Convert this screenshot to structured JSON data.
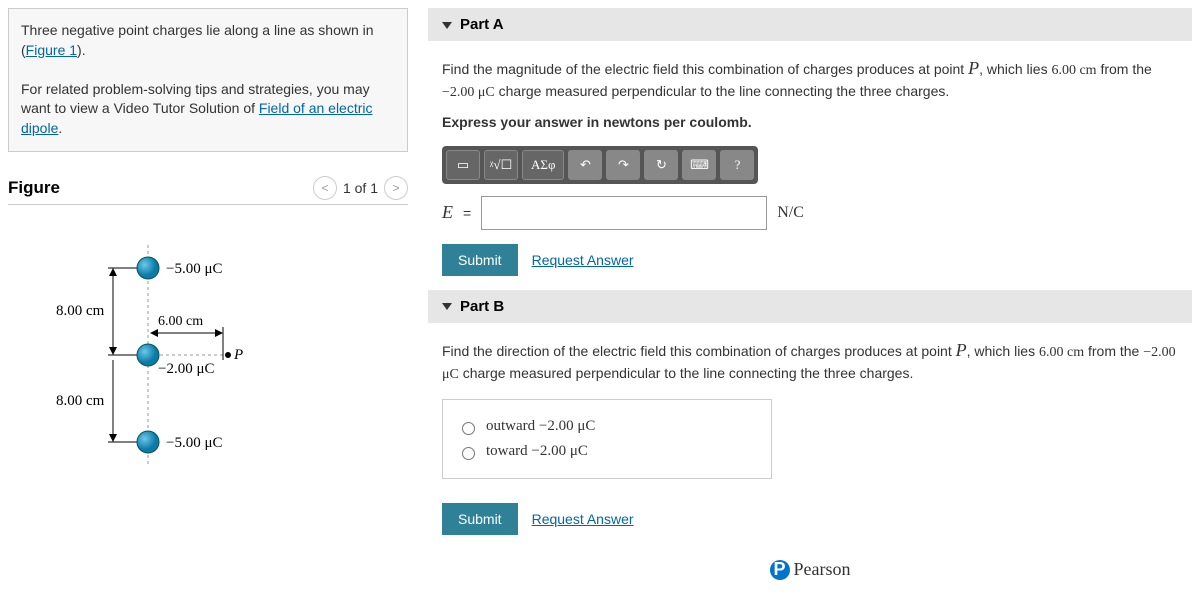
{
  "intro": {
    "l1a": "Three negative point charges lie along a line as shown in (",
    "l1_link": "Figure 1",
    "l1b": ").",
    "l2": "For related problem-solving tips and strategies, you may want to view a Video Tutor Solution of ",
    "l2_link": "Field of an electric dipole",
    "l2b": "."
  },
  "figure": {
    "title": "Figure",
    "counter": "1 of 1",
    "labels": {
      "q1": "−5.00 μC",
      "q2": "−2.00 μC",
      "q3": "−5.00 μC",
      "d1": "8.00 cm",
      "d2": "8.00 cm",
      "dP": "6.00 cm",
      "P": "P"
    }
  },
  "partA": {
    "title": "Part A",
    "q1": "Find the magnitude of the electric field this combination of charges produces at point ",
    "pvar": "P",
    "q2": ", which lies ",
    "dist": "6.00 cm",
    "q3": " from the ",
    "charge": "−2.00 μC",
    "q4": " charge measured perpendicular to the line connecting the three charges.",
    "instr": "Express your answer in newtons per coulomb.",
    "tools": {
      "tmpl": "▭",
      "sqrt": "ᵡ√☐",
      "greek": "ΑΣφ",
      "undo": "↶",
      "redo": "↷",
      "reset": "↻",
      "kbd": "⌨",
      "help": "?"
    },
    "var": "E",
    "eq": "=",
    "unit": "N/C",
    "submit": "Submit",
    "request": "Request Answer"
  },
  "partB": {
    "title": "Part B",
    "q1": "Find the direction of the electric field this combination of charges produces at point ",
    "pvar": "P",
    "q2": ", which lies ",
    "dist": "6.00 cm",
    "q3": " from the ",
    "charge": "−2.00 μC",
    "q4": " charge measured perpendicular to the line connecting the three charges.",
    "opt1a": "outward ",
    "opt1b": "−2.00 μC",
    "opt2a": "toward ",
    "opt2b": "−2.00 μC",
    "submit": "Submit",
    "request": "Request Answer"
  },
  "footer": {
    "brand": "Pearson",
    "p": "P"
  }
}
